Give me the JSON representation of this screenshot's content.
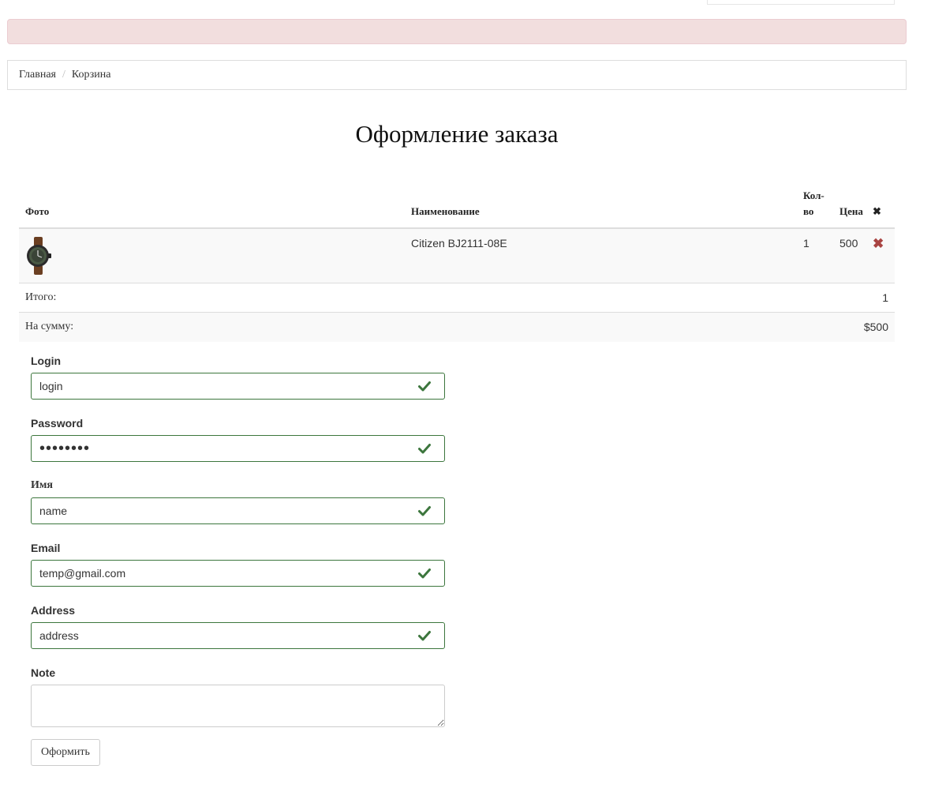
{
  "breadcrumb": {
    "home": "Главная",
    "separator": "/",
    "current": "Корзина"
  },
  "page_title": "Оформление заказа",
  "cart": {
    "headers": {
      "photo": "Фото",
      "name": "Наименование",
      "qty": "Кол-во",
      "price": "Цена",
      "delete": "✖"
    },
    "items": [
      {
        "photo_icon": "watch-icon",
        "name": "Citizen BJ2111-08E",
        "qty": "1",
        "price": "500",
        "delete": "✖"
      }
    ],
    "total_label": "Итого:",
    "total_value": "1",
    "sum_label": "На сумму:",
    "sum_value": "$500"
  },
  "form": {
    "login": {
      "label": "Login",
      "value": "login"
    },
    "password": {
      "label": "Password",
      "value": "password"
    },
    "name": {
      "label": "Имя",
      "value": "name"
    },
    "email": {
      "label": "Email",
      "value": "temp@gmail.com"
    },
    "address": {
      "label": "Address",
      "value": "address"
    },
    "note": {
      "label": "Note",
      "value": ""
    },
    "submit_label": "Оформить"
  },
  "colors": {
    "alert_bg": "#f2dede",
    "success": "#3c763d",
    "danger": "#a94442"
  }
}
